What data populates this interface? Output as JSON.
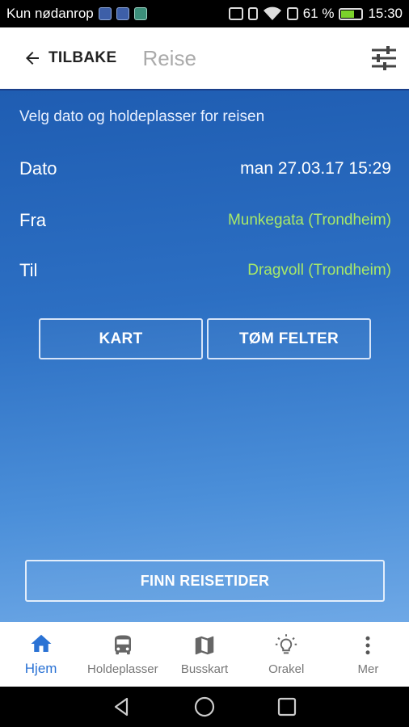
{
  "status_bar": {
    "carrier": "Kun nødanrop",
    "battery_percent": "61 %",
    "battery_level": 0.61,
    "time": "15:30"
  },
  "app_bar": {
    "back_label": "TILBAKE",
    "title": "Reise"
  },
  "main": {
    "prompt": "Velg dato og holdeplasser for reisen",
    "rows": [
      {
        "label": "Dato",
        "value": "man 27.03.17 15:29"
      },
      {
        "label": "Fra",
        "value": "Munkegata (Trondheim)"
      },
      {
        "label": "Til",
        "value": "Dragvoll (Trondheim)"
      }
    ],
    "buttons": {
      "kart": "KART",
      "tom_felter": "TØM FELTER",
      "finn_reisetider": "FINN REISETIDER"
    }
  },
  "bottom_nav": {
    "items": [
      {
        "label": "Hjem",
        "icon": "home-icon",
        "active": true
      },
      {
        "label": "Holdeplasser",
        "icon": "bus-icon"
      },
      {
        "label": "Busskart",
        "icon": "map-icon"
      },
      {
        "label": "Orakel",
        "icon": "lightbulb-icon"
      },
      {
        "label": "Mer",
        "icon": "more-vert-icon"
      }
    ]
  },
  "colors": {
    "accent_blue": "#2a72d4",
    "location_green": "#a7e868",
    "header_border": "#1a3f8a"
  }
}
